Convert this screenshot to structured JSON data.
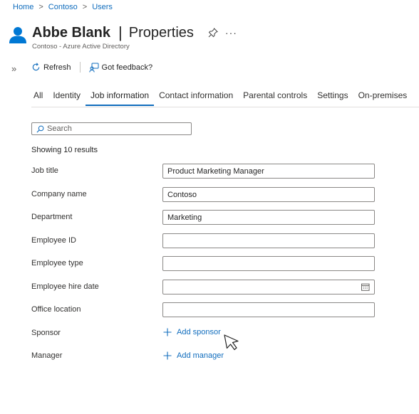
{
  "breadcrumb": {
    "items": [
      "Home",
      "Contoso",
      "Users"
    ],
    "separator": ">"
  },
  "header": {
    "user_name": "Abbe Blank",
    "divider": "|",
    "page_title": "Properties",
    "subtitle": "Contoso - Azure Active Directory",
    "more_label": "···"
  },
  "toolbar": {
    "expand_label": "»",
    "refresh_label": "Refresh",
    "feedback_label": "Got feedback?"
  },
  "tabs": [
    {
      "label": "All",
      "active": false
    },
    {
      "label": "Identity",
      "active": false
    },
    {
      "label": "Job information",
      "active": true
    },
    {
      "label": "Contact information",
      "active": false
    },
    {
      "label": "Parental controls",
      "active": false
    },
    {
      "label": "Settings",
      "active": false
    },
    {
      "label": "On-premises",
      "active": false
    }
  ],
  "search": {
    "placeholder": "Search",
    "value": ""
  },
  "results_text": "Showing 10 results",
  "fields": {
    "job_title": {
      "label": "Job title",
      "value": "Product Marketing Manager"
    },
    "company_name": {
      "label": "Company name",
      "value": "Contoso"
    },
    "department": {
      "label": "Department",
      "value": "Marketing"
    },
    "employee_id": {
      "label": "Employee ID",
      "value": ""
    },
    "employee_type": {
      "label": "Employee type",
      "value": ""
    },
    "employee_hire_date": {
      "label": "Employee hire date",
      "value": ""
    },
    "office_location": {
      "label": "Office location",
      "value": ""
    },
    "sponsor": {
      "label": "Sponsor",
      "action": "Add sponsor"
    },
    "manager": {
      "label": "Manager",
      "action": "Add manager"
    }
  },
  "colors": {
    "accent": "#0f6cbd",
    "user_icon": "#0078d4"
  },
  "icons": {
    "user": "user-icon",
    "pin": "pin-icon",
    "refresh": "refresh-icon",
    "feedback": "feedback-icon",
    "search": "search-icon",
    "calendar": "calendar-icon",
    "add": "plus-icon",
    "pointer": "mouse-pointer-icon"
  }
}
